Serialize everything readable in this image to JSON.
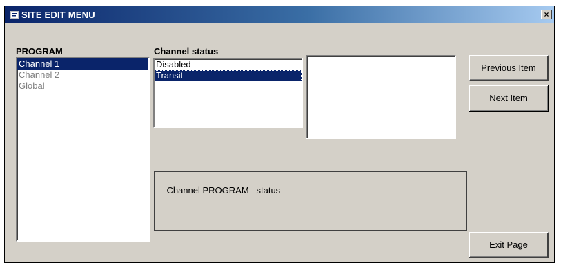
{
  "window": {
    "title": "SITE EDIT MENU",
    "close_label": "×"
  },
  "program": {
    "label": "PROGRAM",
    "items": [
      {
        "label": "Channel 1",
        "selected": true
      },
      {
        "label": "Channel 2",
        "selected": false
      },
      {
        "label": "Global",
        "selected": false
      }
    ]
  },
  "channel_status": {
    "label": "Channel status",
    "items": [
      {
        "label": "Disabled",
        "selected": false
      },
      {
        "label": "Transit",
        "selected": true
      }
    ]
  },
  "status_text": "Channel PROGRAM   status",
  "buttons": {
    "previous": "Previous Item",
    "next": "Next Item",
    "exit": "Exit Page"
  },
  "colors": {
    "selection": "#0a246a",
    "face": "#d4d0c8",
    "titlebar_start": "#0a246a",
    "titlebar_end": "#a6caf0"
  }
}
